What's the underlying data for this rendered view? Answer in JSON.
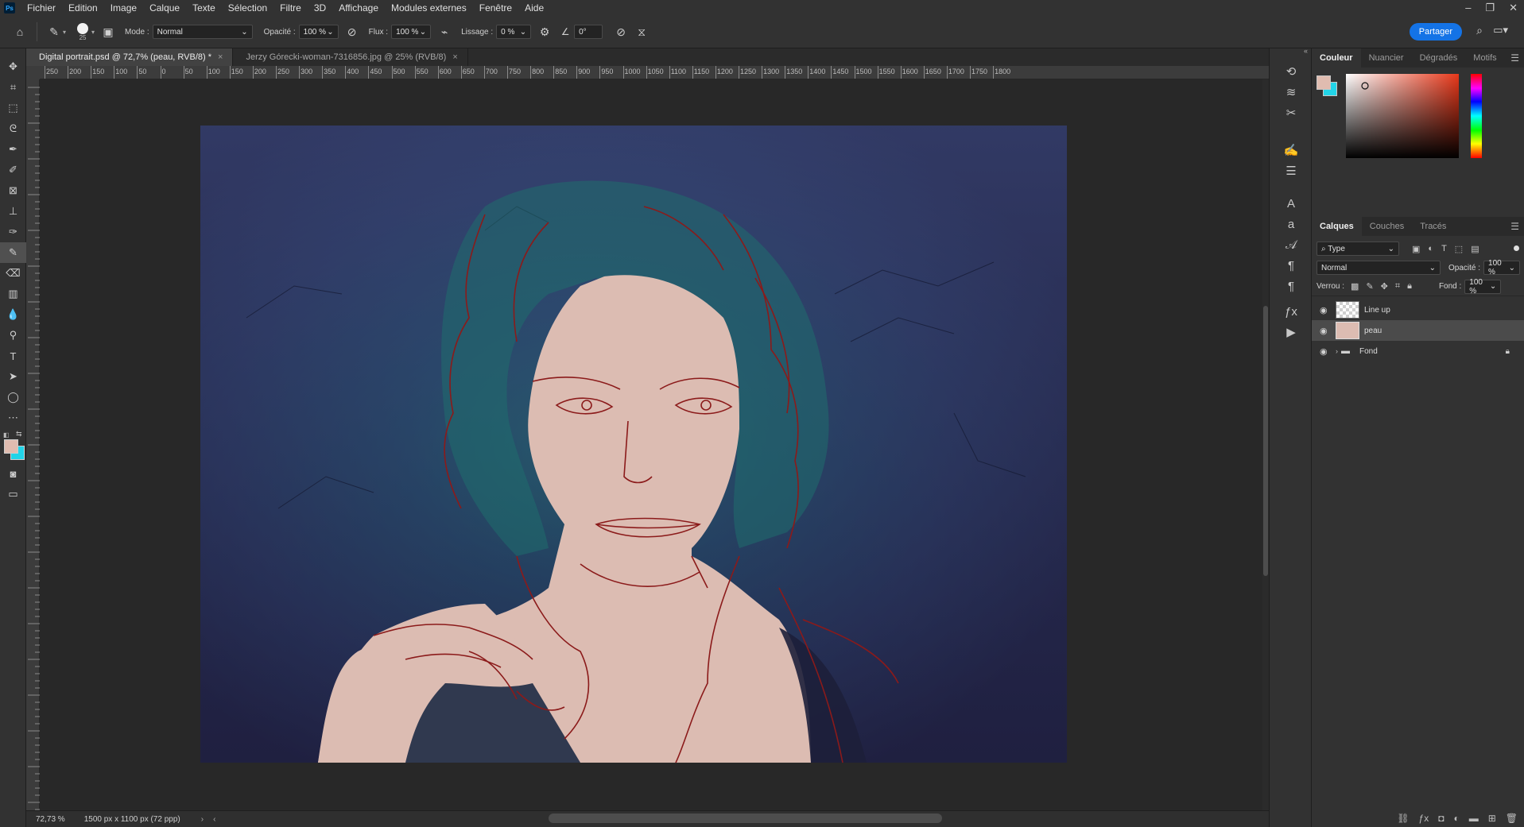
{
  "app": {
    "logo": "Ps"
  },
  "menu": [
    "Fichier",
    "Edition",
    "Image",
    "Calque",
    "Texte",
    "Sélection",
    "Filtre",
    "3D",
    "Affichage",
    "Modules externes",
    "Fenêtre",
    "Aide"
  ],
  "window_controls": [
    "–",
    "❐",
    "✕"
  ],
  "options": {
    "brush_size": "25",
    "mode_label": "Mode :",
    "mode_value": "Normal",
    "opacity_label": "Opacité :",
    "opacity_value": "100 %",
    "flux_label": "Flux :",
    "flux_value": "100 %",
    "smoothing_label": "Lissage :",
    "smoothing_value": "0 %",
    "angle_value": "0°",
    "share_label": "Partager"
  },
  "tabs": [
    {
      "label": "Digital portrait.psd @ 72,7% (peau, RVB/8) *",
      "active": true
    },
    {
      "label": "Jerzy Górecki-woman-7316856.jpg @ 25% (RVB/8)",
      "active": false
    }
  ],
  "ruler": {
    "h_ticks": [
      "250",
      "200",
      "150",
      "100",
      "50",
      "0",
      "50",
      "100",
      "150",
      "200",
      "250",
      "300",
      "350",
      "400",
      "450",
      "500",
      "550",
      "600",
      "650",
      "700",
      "750",
      "800",
      "850",
      "900",
      "950",
      "1000",
      "1050",
      "1100",
      "1150",
      "1200",
      "1250",
      "1300",
      "1350",
      "1400",
      "1450",
      "1500",
      "1550",
      "1600",
      "1650",
      "1700",
      "1750",
      "1800"
    ]
  },
  "status": {
    "zoom": "72,73 %",
    "doc_info": "1500 px x 1100 px (72 ppp)"
  },
  "color_panel": {
    "tabs": [
      "Couleur",
      "Nuancier",
      "Dégradés",
      "Motifs"
    ],
    "foreground": "#e0bcb0",
    "background": "#22d4e8"
  },
  "layers_panel": {
    "tabs": [
      "Calques",
      "Couches",
      "Tracés"
    ],
    "filter_label": "Type",
    "blend_mode": "Normal",
    "opacity_label": "Opacité :",
    "opacity_value": "100 %",
    "lock_label": "Verrou :",
    "fill_label": "Fond :",
    "fill_value": "100 %",
    "layers": [
      {
        "name": "Line up",
        "selected": false
      },
      {
        "name": "peau",
        "selected": true
      },
      {
        "name": "Fond",
        "selected": false,
        "locked": true,
        "group": true
      }
    ]
  }
}
